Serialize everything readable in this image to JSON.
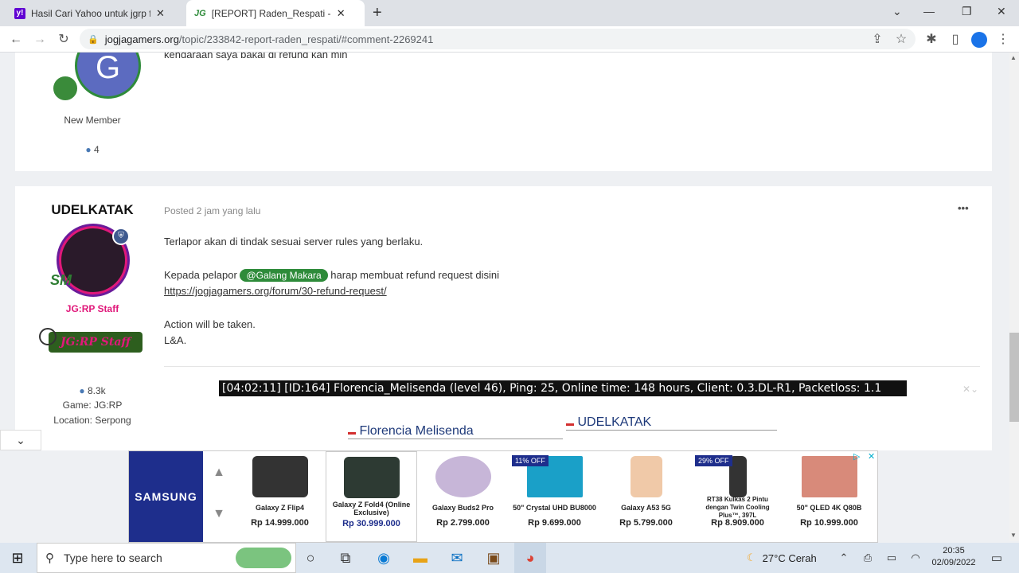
{
  "browser": {
    "tabs": [
      {
        "icon": "yahoo-favicon",
        "title": "Hasil Cari Yahoo untuk jgrp forum",
        "close": "✕"
      },
      {
        "icon": "jg-favicon",
        "title": "[REPORT] Raden_Respati - Archive",
        "close": "✕"
      }
    ],
    "new_tab": "+",
    "url_host": "jogjagamers.org",
    "url_path": "/topic/233842-report-raden_respati/#comment-2269241",
    "window_controls": [
      "⌄",
      "—",
      "❐",
      "✕"
    ]
  },
  "post1": {
    "avatar_letter": "G",
    "partial_text": "kendaraan saya bakal di refund kan min",
    "rank": "New Member",
    "post_count": "4"
  },
  "post2": {
    "author": "UDELKATAK",
    "posted": "Posted 2 jam yang lalu",
    "more": "•••",
    "line1": "Terlapor akan di tindak sesuai server rules yang berlaku.",
    "line2_pre": "Kepada pelapor",
    "mention": "@Galang Makara",
    "line2_post": "harap membuat refund request disini",
    "link": "https://jogjagamers.org/forum/30-refund-request/",
    "line3": "Action will be taken.",
    "line4": "L&A.",
    "group": "JG:RP Staff",
    "badge_text": "JG:RP Staff",
    "reputation": "8.3k",
    "game": "Game: JG:RP",
    "location": "Location: Serpong",
    "overlay": "[04:02:11] [ID:164] Florencia_Melisenda (level 46), Ping: 25, Online time: 148 hours, Client: 0.3.DL-R1, Packetloss: 1.1",
    "name_left": "Florencia Melisenda",
    "name_right": "UDELKATAK"
  },
  "ad": {
    "brand": "SAMSUNG",
    "products": [
      {
        "name": "Galaxy Z Flip4",
        "price": "Rp 14.999.000",
        "badge": ""
      },
      {
        "name": "Galaxy Z Fold4 (Online Exclusive)",
        "price": "Rp 30.999.000",
        "badge": ""
      },
      {
        "name": "Galaxy Buds2 Pro",
        "price": "Rp 2.799.000",
        "badge": ""
      },
      {
        "name": "50\" Crystal UHD BU8000",
        "price": "Rp 9.699.000",
        "badge": "11% OFF"
      },
      {
        "name": "Galaxy A53 5G",
        "price": "Rp 5.799.000",
        "badge": ""
      },
      {
        "name": "RT38 Kulkas 2 Pintu dengan Twin Cooling Plus™, 397L",
        "price": "Rp 8.909.000",
        "badge": "29% OFF"
      },
      {
        "name": "50\" QLED 4K Q80B",
        "price": "Rp 10.999.000",
        "badge": ""
      }
    ]
  },
  "taskbar": {
    "search_placeholder": "Type here to search",
    "weather": "27°C  Cerah",
    "time": "20:35",
    "date": "02/09/2022"
  },
  "colors": {
    "accent_green": "#2e8b3a",
    "staff_pink": "#e0187a",
    "samsung_blue": "#1e2e8c"
  }
}
